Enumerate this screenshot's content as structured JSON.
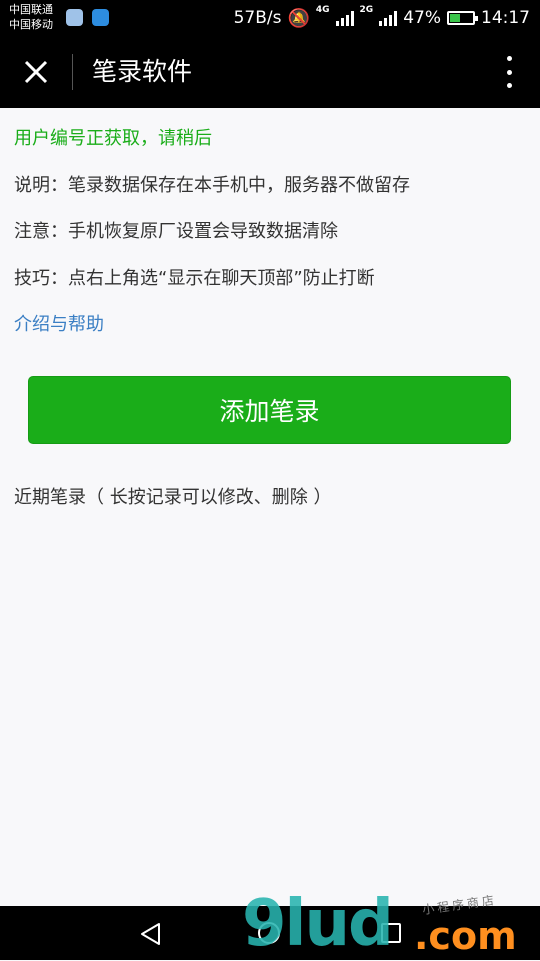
{
  "status_bar": {
    "carrier1": "中国联通",
    "carrier2": "中国移动",
    "speed": "57B/s",
    "net1": "4G",
    "net2": "2G",
    "battery": "47%",
    "battery_level": 0.47,
    "time": "14:17"
  },
  "title_bar": {
    "title": "笔录软件"
  },
  "content": {
    "status_message": "用户编号正获取，请稍后",
    "info1": "说明：笔录数据保存在本手机中，服务器不做留存",
    "info2": "注意：手机恢复原厂设置会导致数据清除",
    "info3": "技巧：点右上角选“显示在聊天顶部”防止打断",
    "help_link": "介绍与帮助",
    "add_button": "添加笔录",
    "recent_label": "近期笔录（ 长按记录可以修改、删除 ）"
  },
  "watermark": {
    "main": "9lud",
    "suffix": ".com",
    "sub": "小程序商店"
  },
  "colors": {
    "accent": "#1aad19",
    "link": "#3b7fc4",
    "bar": "#000000"
  }
}
